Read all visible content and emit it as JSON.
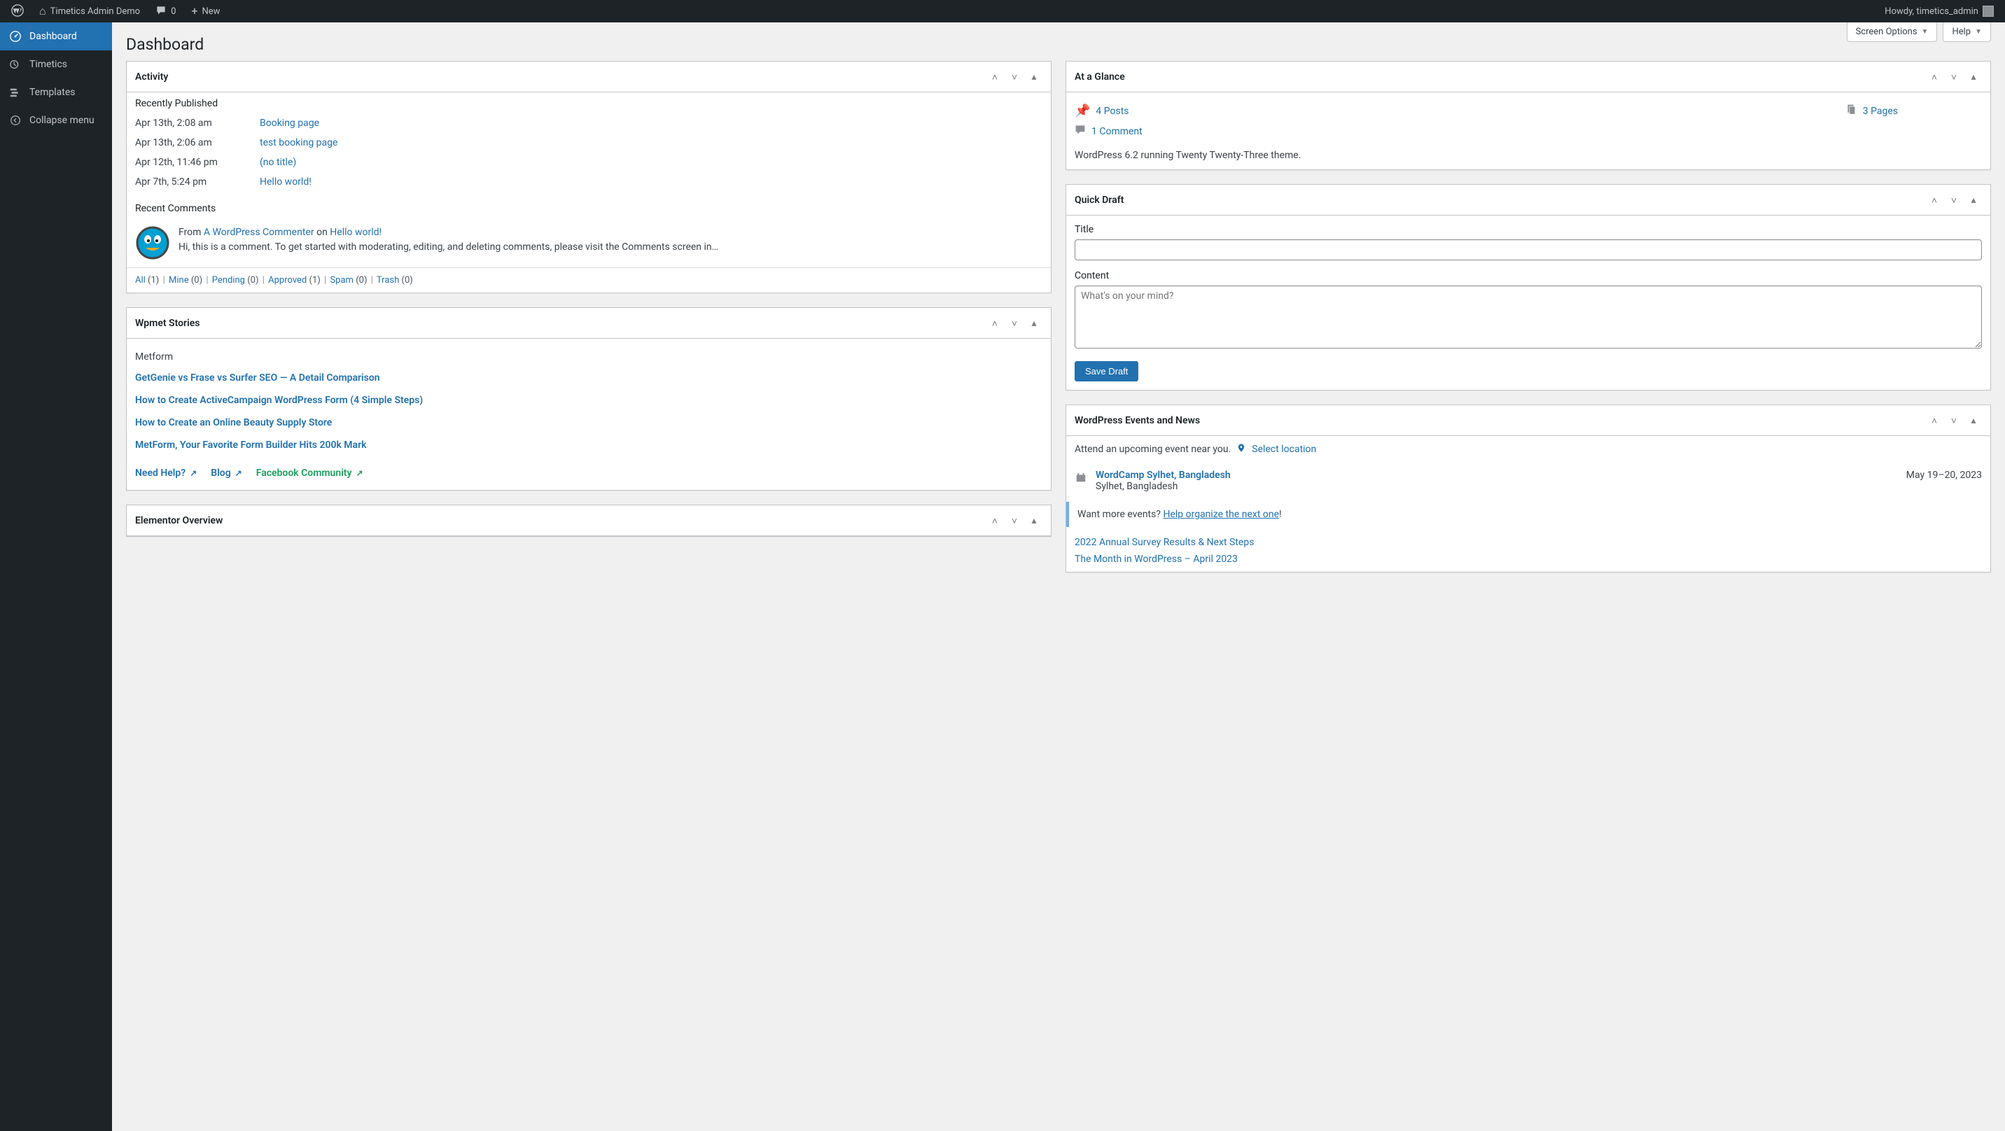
{
  "adminbar": {
    "site_name": "Timetics Admin Demo",
    "comment_count": "0",
    "new_label": "New",
    "howdy": "Howdy, timetics_admin"
  },
  "sidebar": {
    "items": [
      {
        "label": "Dashboard"
      },
      {
        "label": "Timetics"
      },
      {
        "label": "Templates"
      },
      {
        "label": "Collapse menu"
      }
    ]
  },
  "tabs": {
    "screen_options": "Screen Options",
    "help": "Help"
  },
  "page_title": "Dashboard",
  "activity": {
    "title": "Activity",
    "recently_published": "Recently Published",
    "posts": [
      {
        "date": "Apr 13th, 2:08 am",
        "title": "Booking page"
      },
      {
        "date": "Apr 13th, 2:06 am",
        "title": "test booking page"
      },
      {
        "date": "Apr 12th, 11:46 pm",
        "title": "(no title)"
      },
      {
        "date": "Apr 7th, 5:24 pm",
        "title": "Hello world!"
      }
    ],
    "recent_comments": "Recent Comments",
    "comment": {
      "from_label": "From",
      "author": "A WordPress Commenter",
      "on_label": "on",
      "post": "Hello world!",
      "excerpt": "Hi, this is a comment. To get started with moderating, editing, and deleting comments, please visit the Comments screen in…"
    },
    "filters": {
      "all": "All",
      "all_c": "(1)",
      "mine": "Mine",
      "mine_c": "(0)",
      "pending": "Pending",
      "pending_c": "(0)",
      "approved": "Approved",
      "approved_c": "(1)",
      "spam": "Spam",
      "spam_c": "(0)",
      "trash": "Trash",
      "trash_c": "(0)"
    }
  },
  "wpmet": {
    "title": "Wpmet Stories",
    "sub": "Metform",
    "stories": [
      "GetGenie vs Frase vs Surfer SEO — A Detail Comparison",
      "How to Create ActiveCampaign WordPress Form (4 Simple Steps)",
      "How to Create an Online Beauty Supply Store",
      "MetForm, Your Favorite Form Builder Hits 200k Mark"
    ],
    "footer": {
      "help": "Need Help?",
      "blog": "Blog",
      "fb": "Facebook Community"
    }
  },
  "elementor": {
    "title": "Elementor Overview"
  },
  "glance": {
    "title": "At a Glance",
    "posts": "4 Posts",
    "pages": "3 Pages",
    "comments": "1 Comment",
    "version_text": "WordPress 6.2 running Twenty Twenty-Three theme."
  },
  "quickdraft": {
    "title": "Quick Draft",
    "title_label": "Title",
    "content_label": "Content",
    "content_placeholder": "What's on your mind?",
    "save": "Save Draft"
  },
  "events": {
    "title": "WordPress Events and News",
    "attend": "Attend an upcoming event near you.",
    "select_location": "Select location",
    "event": {
      "name": "WordCamp Sylhet, Bangladesh",
      "loc": "Sylhet, Bangladesh",
      "date": "May 19–20, 2023"
    },
    "more_prefix": "Want more events? ",
    "more_link": "Help organize the next one",
    "more_suffix": "!",
    "news": [
      "2022 Annual Survey Results & Next Steps",
      "The Month in WordPress – April 2023"
    ]
  }
}
